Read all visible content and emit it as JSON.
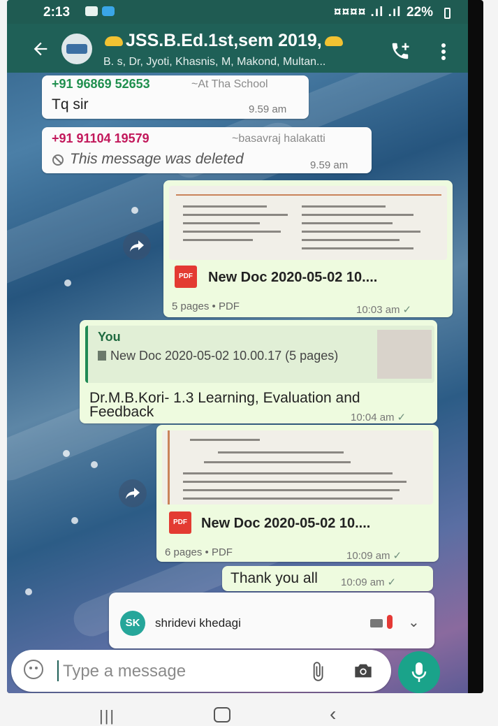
{
  "status_bar": {
    "time": "2:13",
    "signal": "¤¤¤¤ .ıl .ıl",
    "battery": "22%"
  },
  "header": {
    "title": "JSS.B.Ed.1st,sem 2019,",
    "subtitle": "B. s, Dr, Jyoti, Khasnis, M, Makond, Multan..."
  },
  "messages": [
    {
      "sender_phone": "+91 96869 52653",
      "sender_name": "~At Tha School",
      "text": "Tq sir",
      "time": "9.59 am",
      "phone_color": "#1f8f4e"
    },
    {
      "sender_phone": "+91 91104 19579",
      "sender_name": "~basavraj halakatti",
      "text": "This message was deleted",
      "time": "9.59 am",
      "phone_color": "#c2185b"
    },
    {
      "doc_name": "New Doc 2020-05-02 10....",
      "doc_meta": "5 pages • PDF",
      "time": "10:03 am",
      "pdf_label": "PDF"
    },
    {
      "quote_author": "You",
      "quote_text": "New Doc 2020-05-02 10.00.17 (5 pages)",
      "text_line1": "Dr.M.B.Kori- 1.3 Learning,  Evaluation and",
      "text_line2": "Feedback",
      "time": "10:04 am"
    },
    {
      "doc_name": "New Doc 2020-05-02 10....",
      "doc_meta": "6 pages • PDF",
      "time": "10:09 am",
      "pdf_label": "PDF"
    },
    {
      "text": "Thank you all",
      "time": "10:09 am"
    }
  ],
  "call_bar": {
    "initials": "SK",
    "name": "shridevi khedagi"
  },
  "input": {
    "placeholder": "Type a message"
  },
  "icons": {
    "back": "back-arrow-icon",
    "call_add": "add-call-icon",
    "menu": "more-vert-icon",
    "forward": "forward-icon",
    "attach": "paperclip-icon",
    "camera": "camera-icon",
    "mic": "mic-icon",
    "emoji": "emoji-icon"
  },
  "colors": {
    "header": "#1f6057",
    "outgoing_bubble": "#eefbdf",
    "accent": "#1aa38a"
  }
}
